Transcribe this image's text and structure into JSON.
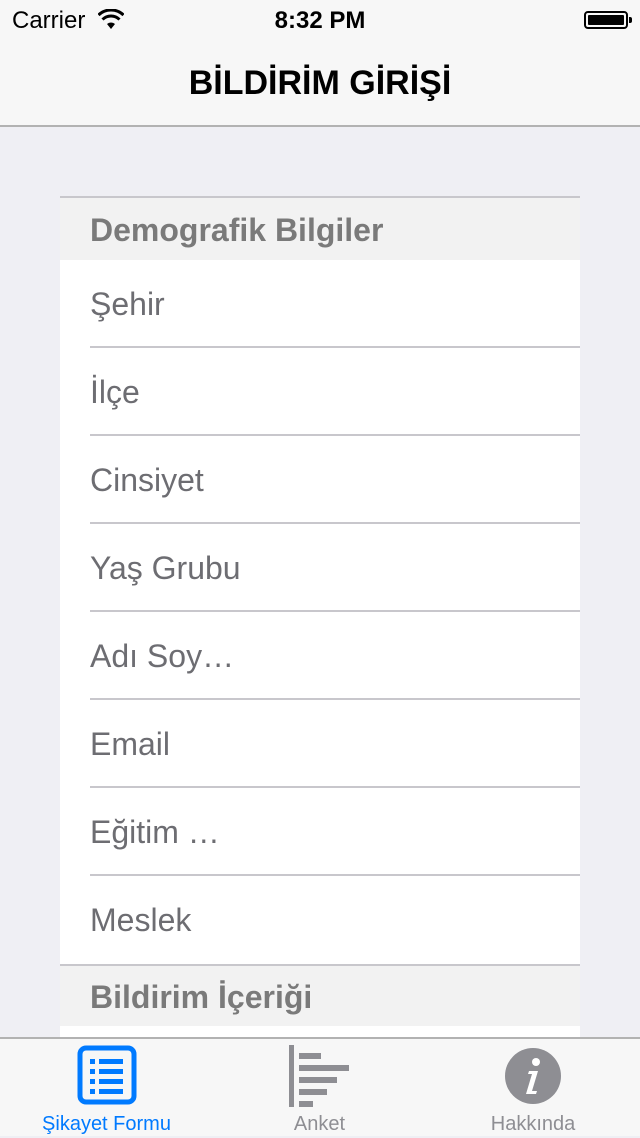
{
  "status_bar": {
    "carrier": "Carrier",
    "time": "8:32 PM"
  },
  "nav": {
    "title": "BİLDİRİM GİRİŞİ"
  },
  "form": {
    "section1_title": "Demografik Bilgiler",
    "fields": [
      "Şehir",
      "İlçe",
      "Cinsiyet",
      "Yaş Grubu",
      "Adı Soy…",
      "Email",
      "Eğitim …",
      "Meslek"
    ],
    "section2_title": "Bildirim İçeriği"
  },
  "tabs": [
    {
      "label": "Şikayet Formu",
      "icon": "list-icon",
      "active": true
    },
    {
      "label": "Anket",
      "icon": "chart-icon",
      "active": false
    },
    {
      "label": "Hakkında",
      "icon": "info-icon",
      "active": false
    }
  ],
  "colors": {
    "accent": "#007aff",
    "inactive": "#8e8e93",
    "background": "#efeff4"
  }
}
